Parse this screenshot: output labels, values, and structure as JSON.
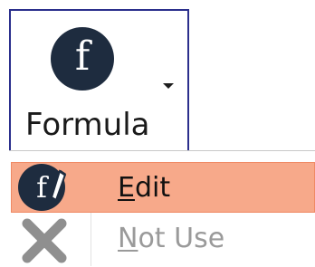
{
  "ribbon_button": {
    "icon": "formula-f-icon",
    "icon_glyph": "f",
    "label": "Formula",
    "dropdown_icon": "dropdown-arrow-icon",
    "border_color": "#2b2f8c",
    "icon_color": "#1e2c3f"
  },
  "menu": {
    "items": [
      {
        "icon": "formula-edit-icon",
        "icon_glyph": "f",
        "mnemonic": "E",
        "rest": "dit",
        "state": "highlighted",
        "highlight_color": "#f7a98a"
      },
      {
        "icon": "close-x-icon",
        "mnemonic": "N",
        "rest": "ot Use",
        "state": "disabled",
        "text_color": "#9a9a9a"
      }
    ]
  }
}
